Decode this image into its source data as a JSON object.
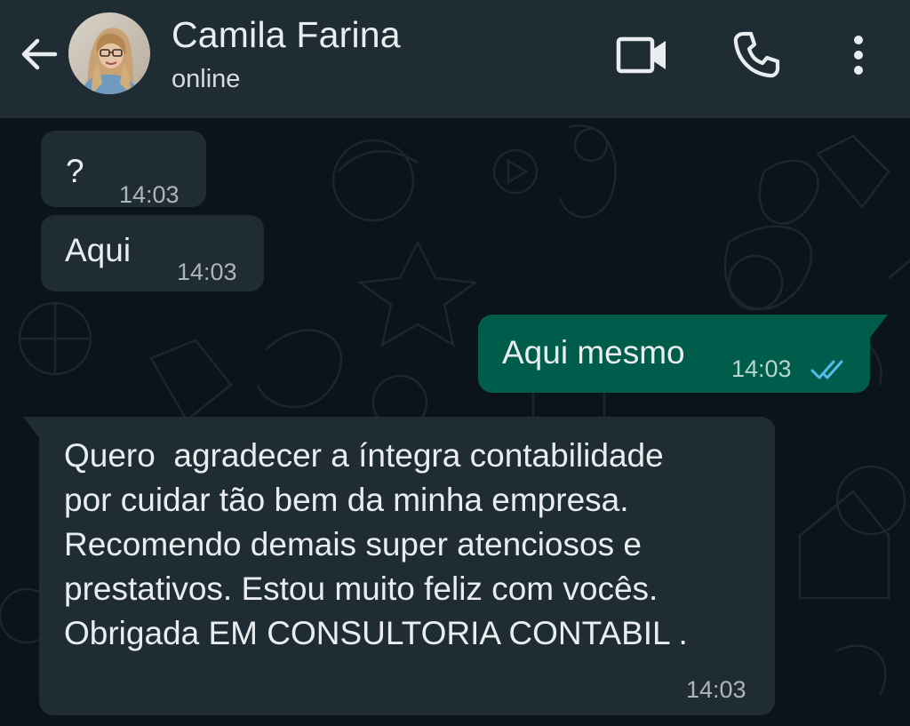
{
  "header": {
    "contact_name": "Camila Farina",
    "status": "online",
    "icons": [
      "back-arrow-icon",
      "video-call-icon",
      "phone-call-icon",
      "more-options-icon"
    ]
  },
  "messages": [
    {
      "direction": "incoming",
      "text": "?",
      "time": "14:03"
    },
    {
      "direction": "incoming",
      "text": "Aqui",
      "time": "14:03"
    },
    {
      "direction": "outgoing",
      "text": "Aqui mesmo",
      "time": "14:03",
      "status": "read"
    },
    {
      "direction": "incoming",
      "lines": [
        "Quero  agradecer a íntegra contabilidade",
        "por cuidar tão bem da minha empresa.",
        "Recomendo demais super atenciosos e",
        "prestativos. Estou muito feliz com vocês.",
        "Obrigada EM CONSULTORIA CONTABIL ."
      ],
      "time": "14:03"
    }
  ],
  "colors": {
    "header_bg": "#1f2c34",
    "chat_bg": "#0b141a",
    "incoming_bubble": "#1f2c34",
    "outgoing_bubble": "#005c4b",
    "read_ticks": "#53bdeb"
  }
}
